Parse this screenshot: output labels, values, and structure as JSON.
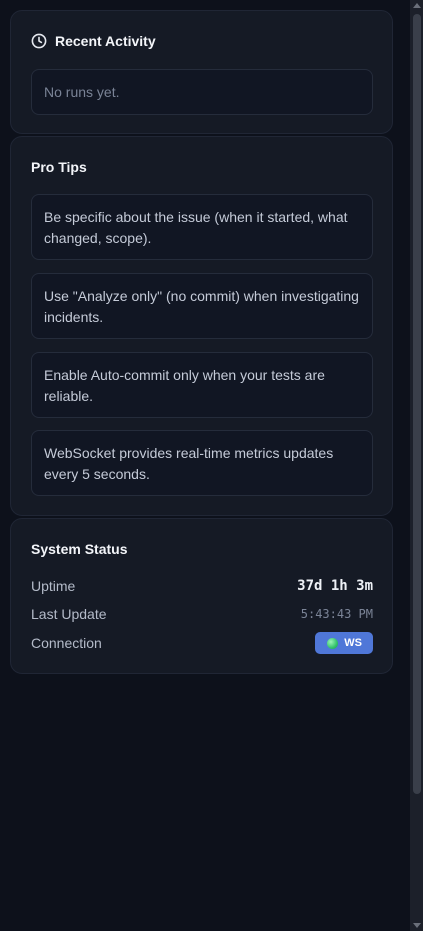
{
  "recent_activity": {
    "title": "Recent Activity",
    "icon": "clock-icon",
    "empty_text": "No runs yet."
  },
  "pro_tips": {
    "title": "Pro Tips",
    "tips": [
      "Be specific about the issue (when it started, what changed, scope).",
      "Use \"Analyze only\" (no commit) when investigating incidents.",
      "Enable Auto-commit only when your tests are reliable.",
      "WebSocket provides real-time metrics updates every 5 seconds."
    ]
  },
  "system_status": {
    "title": "System Status",
    "uptime_label": "Uptime",
    "uptime_value": "37d 1h 3m",
    "last_update_label": "Last Update",
    "last_update_value": "5:43:43 PM",
    "connection_label": "Connection",
    "connection_badge": "WS"
  },
  "colors": {
    "background": "#0d111b",
    "card": "#151a25",
    "badge": "#4f77d8",
    "status_dot": "#32c26a"
  }
}
